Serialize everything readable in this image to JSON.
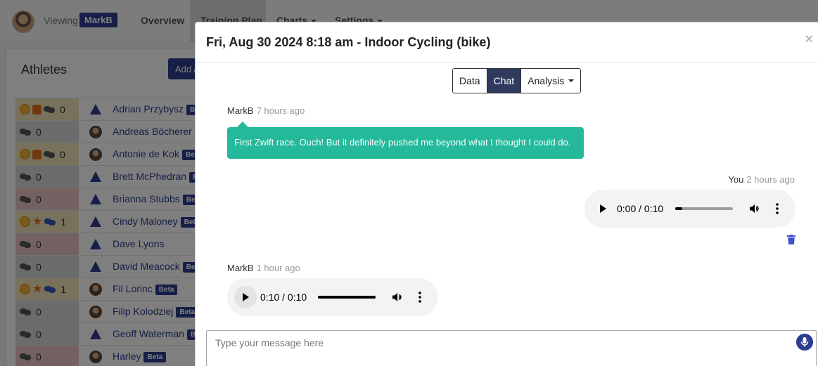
{
  "nav": {
    "viewing_label": "Viewing",
    "user_badge": "MarkB",
    "links": [
      "Overview",
      "Training Plan",
      "Charts",
      "Settings"
    ]
  },
  "athletes_panel": {
    "title": "Athletes",
    "add_button": "Add A",
    "beta_label": "Beta",
    "rows": [
      {
        "name": "Adrian Przybysz",
        "count": "0",
        "tint": "yellow",
        "extras": "emoji-thumb",
        "icon": "triangle-logo-icon",
        "beta": true
      },
      {
        "name": "Andreas Böcherer",
        "count": "0",
        "tint": "gray",
        "extras": "",
        "icon": "athlete-photo-icon",
        "beta": false
      },
      {
        "name": "Antonie de Kok",
        "count": "0",
        "tint": "yellow",
        "extras": "emoji-thumb",
        "icon": "athlete-photo-icon",
        "beta": true
      },
      {
        "name": "Brett McPhedran",
        "count": "0",
        "tint": "gray",
        "extras": "",
        "icon": "triangle-logo-icon",
        "beta": true
      },
      {
        "name": "Brianna Stubbs",
        "count": "0",
        "tint": "pink",
        "extras": "",
        "icon": "triangle-logo-icon",
        "beta": true
      },
      {
        "name": "Cindy Maloney",
        "count": "1",
        "tint": "yellow",
        "extras": "emoji-star",
        "icon": "triangle-logo-icon",
        "beta": true
      },
      {
        "name": "Dave Lyons",
        "count": "0",
        "tint": "pink",
        "extras": "",
        "icon": "triangle-logo-icon",
        "beta": false
      },
      {
        "name": "David Meacock",
        "count": "0",
        "tint": "gray",
        "extras": "",
        "icon": "triangle-logo-icon",
        "beta": true
      },
      {
        "name": "Fil Lorinc",
        "count": "1",
        "tint": "yellow",
        "extras": "emoji-star",
        "icon": "athlete-photo-icon",
        "beta": true
      },
      {
        "name": "Filip Kolodziej",
        "count": "0",
        "tint": "gray",
        "extras": "",
        "icon": "athlete-photo-icon",
        "beta": true
      },
      {
        "name": "Geoff Waterman",
        "count": "0",
        "tint": "gray",
        "extras": "",
        "icon": "triangle-logo-icon",
        "beta": true
      },
      {
        "name": "Harley",
        "count": "0",
        "tint": "pink",
        "extras": "",
        "icon": "athlete-photo-icon",
        "beta": true
      }
    ]
  },
  "modal": {
    "title": "Fri, Aug 30 2024 8:18 am - Indoor Cycling (bike)",
    "close_glyph": "×",
    "tabs": [
      "Data",
      "Chat",
      "Analysis"
    ],
    "active_tab": "Chat",
    "messages": [
      {
        "author": "MarkB",
        "time": "7 hours ago",
        "text": "First Zwift race. Ouch! But it definitely pushed me beyond what I thought I could do."
      },
      {
        "author": "You",
        "time": "2 hours ago",
        "audio_time": "0:00 / 0:10",
        "progress": 0.12
      },
      {
        "author": "MarkB",
        "time": "1 hour ago",
        "audio_time": "0:10 / 0:10",
        "progress": 1.0
      }
    ],
    "composer_placeholder": "Type your message here"
  },
  "colors": {
    "brand": "#2c3e8f",
    "bubble": "#23b99a",
    "tab_active": "#2f3a5e",
    "audio_bg": "#f1f3f4",
    "trash": "#3b4fd6"
  },
  "icons": [
    "play-icon",
    "volume-icon",
    "more-vertical-icon",
    "trash-icon",
    "microphone-icon",
    "close-icon",
    "chat-bubbles-icon",
    "emoji-icon",
    "thumbs-up-icon",
    "star-icon"
  ]
}
